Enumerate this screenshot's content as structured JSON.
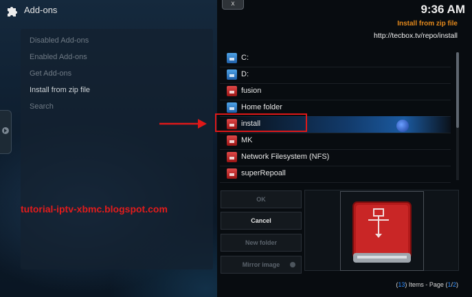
{
  "header": {
    "title": "Add-ons",
    "icon": "puzzle-icon"
  },
  "left_menu": {
    "items": [
      {
        "label": "Disabled Add-ons",
        "active": false
      },
      {
        "label": "Enabled Add-ons",
        "active": false
      },
      {
        "label": "Get Add-ons",
        "active": false
      },
      {
        "label": "Install from zip file",
        "active": true
      },
      {
        "label": "Search",
        "active": false
      }
    ]
  },
  "watermark": "tutorial-iptv-xbmc.blogspot.com",
  "dialog": {
    "close_label": "x",
    "clock": "9:36 AM",
    "heading": "Install from zip file",
    "path": "http://tecbox.tv/repo/install",
    "list": [
      {
        "label": "C:",
        "icon": "drive-blue-icon"
      },
      {
        "label": "D:",
        "icon": "drive-blue-icon"
      },
      {
        "label": "fusion",
        "icon": "network-drive-red-icon"
      },
      {
        "label": "Home folder",
        "icon": "drive-blue-icon"
      },
      {
        "label": "install",
        "icon": "network-drive-red-icon"
      },
      {
        "label": "MK",
        "icon": "network-drive-red-icon"
      },
      {
        "label": "Network Filesystem (NFS)",
        "icon": "network-drive-red-icon"
      },
      {
        "label": "superRepoall",
        "icon": "network-drive-red-icon"
      }
    ],
    "buttons": {
      "ok": "OK",
      "cancel": "Cancel",
      "new_folder": "New folder",
      "mirror_image": "Mirror image"
    },
    "footer": {
      "count": "13",
      "items_text": "Items - Page",
      "page_current": "1",
      "page_total": "2"
    }
  },
  "colors": {
    "heading": "#e58a1c",
    "annotation_red": "#e01818",
    "footer_number": "#2b8cff"
  }
}
